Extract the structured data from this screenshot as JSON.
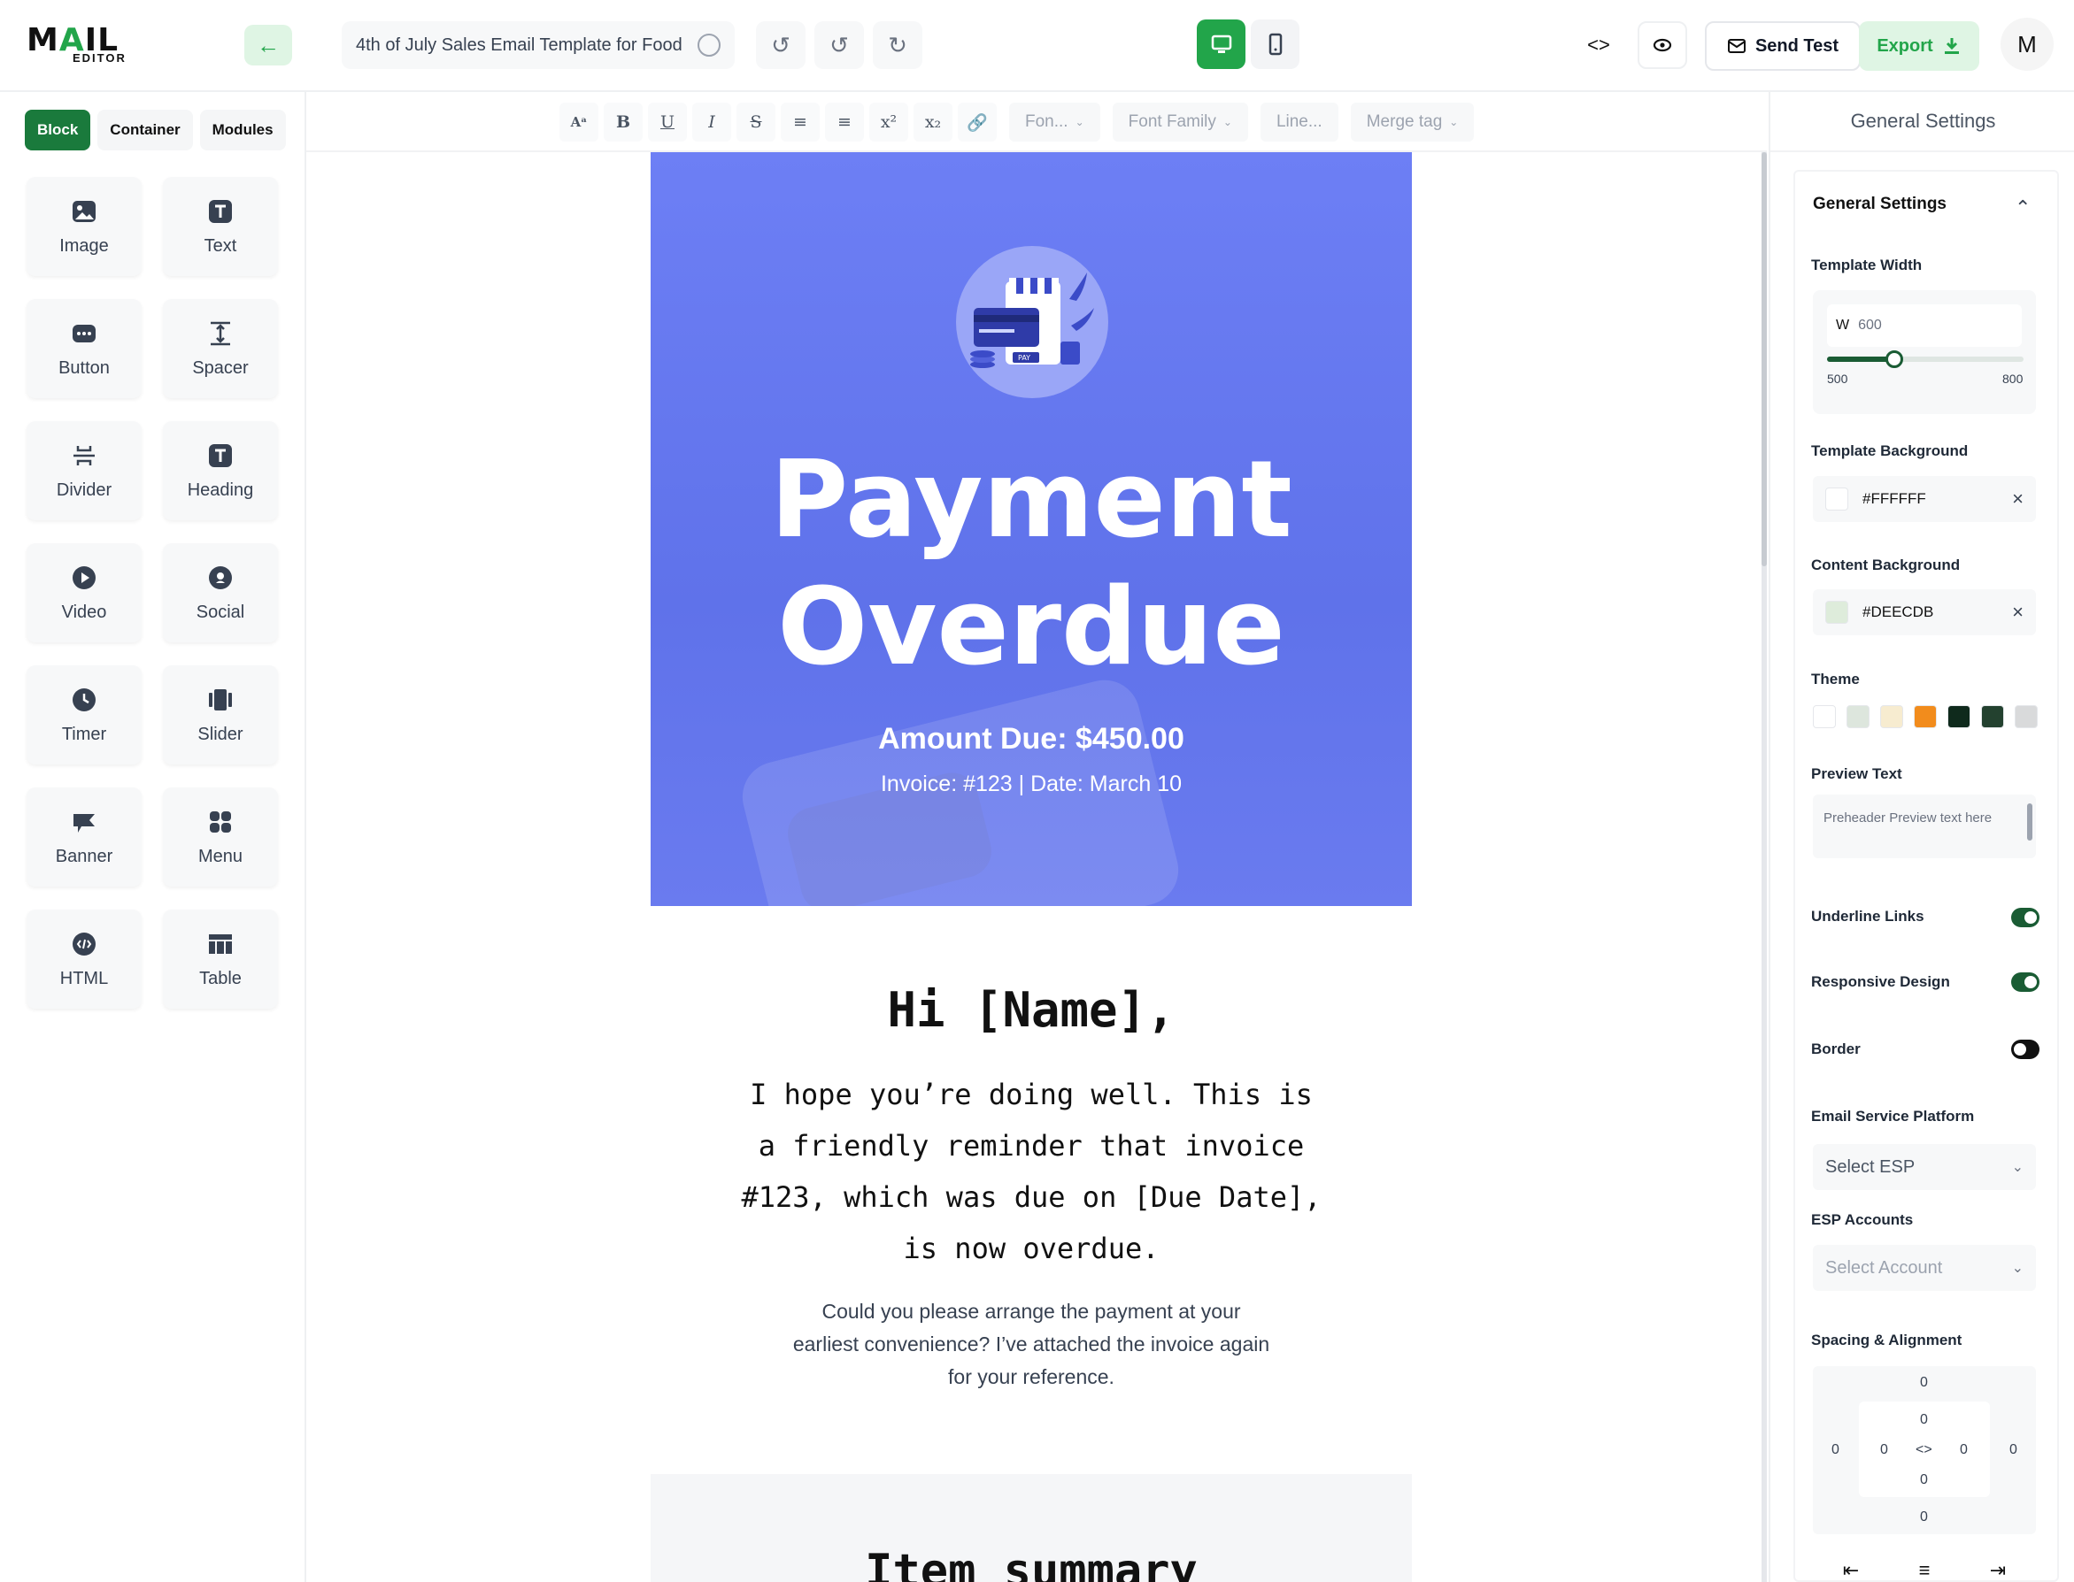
{
  "app": {
    "logo_main": "MAIL",
    "logo_sub": "EDITOR",
    "template_title": "4th of July Sales Email Template for Food",
    "send_test_label": "Send Test",
    "export_label": "Export",
    "avatar_initial": "M",
    "accent_color": "#22a54a"
  },
  "sidebar": {
    "tabs": [
      {
        "label": "Block",
        "active": true
      },
      {
        "label": "Container",
        "active": false
      },
      {
        "label": "Modules",
        "active": false
      }
    ],
    "blocks": [
      {
        "label": "Image",
        "icon": "image-icon"
      },
      {
        "label": "Text",
        "icon": "text-icon"
      },
      {
        "label": "Button",
        "icon": "button-icon"
      },
      {
        "label": "Spacer",
        "icon": "spacer-icon"
      },
      {
        "label": "Divider",
        "icon": "divider-icon"
      },
      {
        "label": "Heading",
        "icon": "heading-icon"
      },
      {
        "label": "Video",
        "icon": "video-icon"
      },
      {
        "label": "Social",
        "icon": "social-icon"
      },
      {
        "label": "Timer",
        "icon": "timer-icon"
      },
      {
        "label": "Slider",
        "icon": "slider-icon"
      },
      {
        "label": "Banner",
        "icon": "banner-icon"
      },
      {
        "label": "Menu",
        "icon": "menu-icon"
      },
      {
        "label": "HTML",
        "icon": "html-icon"
      },
      {
        "label": "Table",
        "icon": "table-icon"
      }
    ]
  },
  "toolbar": {
    "font_size_label": "Fon...",
    "font_family_label": "Font Family",
    "line_height_label": "Line...",
    "merge_tag_label": "Merge tag"
  },
  "email": {
    "hero_title": "Payment Overdue",
    "amount_due": "Amount Due: $450.00",
    "invoice_line": "Invoice: #123 | Date: March 10",
    "greeting": "Hi [Name],",
    "body_primary": "I hope you’re doing well. This is a friendly reminder that invoice #123, which was due on [Due Date], is now overdue.",
    "body_secondary": "Could you please arrange the payment at your earliest convenience? I’ve attached the invoice again for your reference.",
    "summary_title": "Item summary",
    "hero_color": "#6677f0"
  },
  "settings": {
    "panel_title": "General Settings",
    "section_title": "General Settings",
    "template_width_label": "Template Width",
    "width_prefix": "W",
    "width_value": "600",
    "width_min": "500",
    "width_max": "800",
    "template_bg_label": "Template Background",
    "template_bg_value": "#FFFFFF",
    "content_bg_label": "Content Background",
    "content_bg_value": "#DEECDB",
    "theme_label": "Theme",
    "theme_colors": [
      "#ffffff",
      "#dde6dd",
      "#f7ecd0",
      "#f28c1c",
      "#0f2a1c",
      "#23412f",
      "#d9dadb"
    ],
    "preview_text_label": "Preview Text",
    "preview_text_placeholder": "Preheader Preview text here",
    "underline_links_label": "Underline Links",
    "underline_links_on": true,
    "responsive_label": "Responsive Design",
    "responsive_on": true,
    "border_label": "Border",
    "border_on": false,
    "esp_label": "Email Service Platform",
    "esp_placeholder": "Select ESP",
    "esp_accounts_label": "ESP Accounts",
    "esp_accounts_placeholder": "Select Account",
    "spacing_label": "Spacing & Alignment",
    "spacing_values": {
      "margin_top": "0",
      "padding_top": "0",
      "padding_bottom": "0",
      "margin_bottom": "0",
      "margin_left": "0",
      "padding_left": "0",
      "padding_right": "0",
      "margin_right": "0",
      "link_symbol": "<>"
    }
  }
}
